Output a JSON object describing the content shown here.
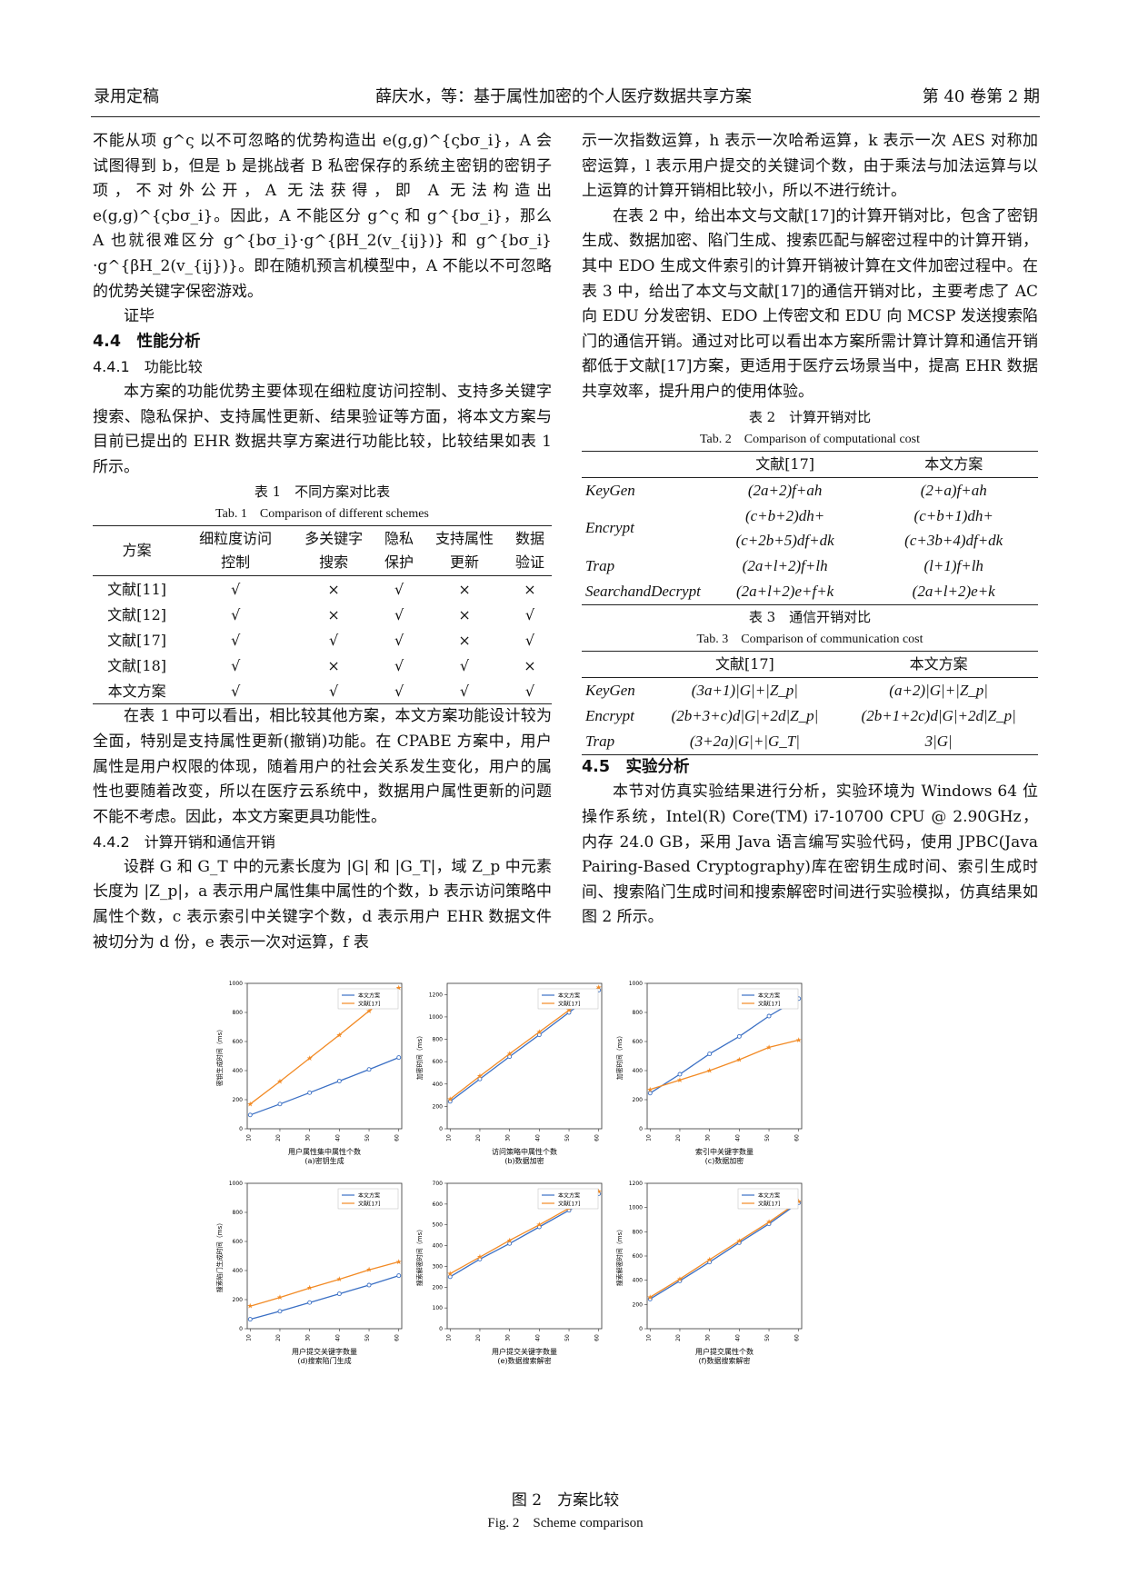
{
  "header": {
    "left": "录用定稿",
    "center": "薛庆水，等：基于属性加密的个人医疗数据共享方案",
    "right": "第 40 卷第 2 期"
  },
  "left": {
    "p1": "不能从项 g^ς 以不可忽略的优势构造出 e(g,g)^{ςbσ_i}，A 会试图得到 b，但是 b 是挑战者 B 私密保存的系统主密钥的密钥子项，不对外公开，A 无法获得，即 A 无法构造出 e(g,g)^{ςbσ_i}。因此，A 不能区分 g^ς 和 g^{bσ_i}，那么 A 也就很难区分 g^{bσ_i}·g^{βH_2(v_{ij})} 和 g^{bσ_i}·g^{βH_2(v_{ij})}。即在随机预言机模型中，A 不能以不可忽略的优势关键字保密游戏。",
    "qed": "证毕",
    "s44": "4.4　性能分析",
    "s441": "4.4.1　功能比较",
    "p2": "本方案的功能优势主要体现在细粒度访问控制、支持多关键字搜索、隐私保护、支持属性更新、结果验证等方面，将本文方案与目前已提出的 EHR 数据共享方案进行功能比较，比较结果如表 1 所示。",
    "t1_cn": "表 1　不同方案对比表",
    "t1_en": "Tab. 1　Comparison of different schemes",
    "p3": "在表 1 中可以看出，相比较其他方案，本文方案功能设计较为全面，特别是支持属性更新(撤销)功能。在 CPABE 方案中，用户属性是用户权限的体现，随着用户的社会关系发生变化，用户的属性也要随着改变，所以在医疗云系统中，数据用户属性更新的问题不能不考虑。因此，本文方案更具功能性。",
    "s442": "4.4.2　计算开销和通信开销",
    "p4": "设群 G 和 G_T 中的元素长度为 |G| 和 |G_T|，域 Z_p 中元素长度为 |Z_p|，a 表示用户属性集中属性的个数，b 表示访问策略中属性个数，c 表示索引中关键字个数，d 表示用户 EHR 数据文件被切分为 d 份，e 表示一次对运算，f 表"
  },
  "right": {
    "p1": "示一次指数运算，h 表示一次哈希运算，k 表示一次 AES 对称加密运算，l 表示用户提交的关键词个数，由于乘法与加法运算与以上运算的计算开销相比较小，所以不进行统计。",
    "p2": "在表 2 中，给出本文与文献[17]的计算开销对比，包含了密钥生成、数据加密、陷门生成、搜索匹配与解密过程中的计算开销，其中 EDO 生成文件索引的计算开销被计算在文件加密过程中。在表 3 中，给出了本文与文献[17]的通信开销对比，主要考虑了 AC 向 EDU 分发密钥、EDO 上传密文和 EDU 向 MCSP 发送搜索陷门的通信开销。通过对比可以看出本方案所需计算计算和通信开销都低于文献[17]方案，更适用于医疗云场景当中，提高 EHR 数据共享效率，提升用户的使用体验。",
    "t2_cn": "表 2　计算开销对比",
    "t2_en": "Tab. 2　Comparison of computational cost",
    "t3_cn": "表 3　通信开销对比",
    "t3_en": "Tab. 3　Comparison of communication cost",
    "s45": "4.5　实验分析",
    "p3": "本节对仿真实验结果进行分析，实验环境为 Windows 64 位操作系统，Intel(R) Core(TM) i7-10700 CPU @ 2.90GHz，内存 24.0 GB，采用 Java 语言编写实验代码，使用 JPBC(Java Pairing-Based Cryptography)库在密钥生成时间、索引生成时间、搜索陷门生成时间和搜索解密时间进行实验模拟，仿真结果如图 2 所示。"
  },
  "table1": {
    "headers": [
      [
        "方案"
      ],
      [
        "细粒度访问",
        "控制"
      ],
      [
        "多关键字",
        "搜索"
      ],
      [
        "隐私",
        "保护"
      ],
      [
        "支持属性",
        "更新"
      ],
      [
        "数据",
        "验证"
      ]
    ],
    "rows": [
      [
        "文献[11]",
        "√",
        "×",
        "√",
        "×",
        "×"
      ],
      [
        "文献[12]",
        "√",
        "×",
        "√",
        "×",
        "√"
      ],
      [
        "文献[17]",
        "√",
        "√",
        "√",
        "×",
        "√"
      ],
      [
        "文献[18]",
        "√",
        "×",
        "√",
        "√",
        "×"
      ],
      [
        "本文方案",
        "√",
        "√",
        "√",
        "√",
        "√"
      ]
    ]
  },
  "table2": {
    "headers": [
      "",
      "文献[17]",
      "本文方案"
    ],
    "rows": [
      [
        "KeyGen",
        "(2a+2)f+ah",
        "(2+a)f+ah"
      ],
      [
        "Encrypt",
        "(c+b+2)dh+ (c+2b+5)df+dk",
        "(c+b+1)dh+ (c+3b+4)df+dk"
      ],
      [
        "Trap",
        "(2a+l+2)f+lh",
        "(l+1)f+lh"
      ],
      [
        "SearchandDecrypt",
        "(2a+l+2)e+f+k",
        "(2a+l+2)e+k"
      ]
    ]
  },
  "table3": {
    "headers": [
      "",
      "文献[17]",
      "本文方案"
    ],
    "rows": [
      [
        "KeyGen",
        "(3a+1)|G|+|Z_p|",
        "(a+2)|G|+|Z_p|"
      ],
      [
        "Encrypt",
        "(2b+3+c)d|G|+2d|Z_p|",
        "(2b+1+2c)d|G|+2d|Z_p|"
      ],
      [
        "Trap",
        "(3+2a)|G|+|G_T|",
        "3|G|"
      ]
    ]
  },
  "figure": {
    "caption_cn": "图 2　方案比较",
    "caption_en": "Fig. 2　Scheme comparison"
  },
  "chart_data": [
    {
      "type": "line",
      "subtitle": "(a)密钥生成",
      "xlabel": "用户属性集中属性个数",
      "ylabel": "密钥生成时间（ms）",
      "x": [
        10,
        20,
        30,
        40,
        50,
        60
      ],
      "ylim": [
        0,
        1000
      ],
      "yticks": [
        0,
        200,
        400,
        600,
        800,
        1000
      ],
      "series": [
        {
          "name": "本文方案",
          "color": "#3a6fc4",
          "values": [
            95,
            170,
            248,
            328,
            408,
            490
          ]
        },
        {
          "name": "文献[17]",
          "color": "#f28a24",
          "values": [
            170,
            325,
            485,
            645,
            810,
            970
          ]
        }
      ]
    },
    {
      "type": "line",
      "subtitle": "(b)数据加密",
      "xlabel": "访问策略中属性个数",
      "ylabel": "加密时间（ms）",
      "x": [
        10,
        20,
        30,
        40,
        50,
        60
      ],
      "ylim": [
        0,
        1300
      ],
      "yticks": [
        0,
        200,
        400,
        600,
        800,
        1000,
        1200
      ],
      "series": [
        {
          "name": "本文方案",
          "color": "#3a6fc4",
          "values": [
            245,
            445,
            645,
            840,
            1040,
            1240
          ]
        },
        {
          "name": "文献[17]",
          "color": "#f28a24",
          "values": [
            265,
            470,
            670,
            865,
            1060,
            1265
          ]
        }
      ]
    },
    {
      "type": "line",
      "subtitle": "(c)数据加密",
      "xlabel": "索引中关键字数量",
      "ylabel": "加密时间（ms）",
      "x": [
        10,
        20,
        30,
        40,
        50,
        60
      ],
      "ylim": [
        0,
        1000
      ],
      "yticks": [
        0,
        200,
        400,
        600,
        800,
        1000
      ],
      "series": [
        {
          "name": "本文方案",
          "color": "#3a6fc4",
          "values": [
            245,
            375,
            515,
            635,
            775,
            895
          ]
        },
        {
          "name": "文献[17]",
          "color": "#f28a24",
          "values": [
            270,
            335,
            400,
            475,
            560,
            610
          ]
        }
      ]
    },
    {
      "type": "line",
      "subtitle": "(d)搜索陷门生成",
      "xlabel": "用户提交关键字数量",
      "ylabel": "搜索陷门生成时间（ms）",
      "x": [
        10,
        20,
        30,
        40,
        50,
        60
      ],
      "ylim": [
        0,
        1000
      ],
      "yticks": [
        0,
        200,
        400,
        600,
        800,
        1000
      ],
      "series": [
        {
          "name": "本文方案",
          "color": "#3a6fc4",
          "values": [
            65,
            120,
            180,
            240,
            300,
            365
          ]
        },
        {
          "name": "文献[17]",
          "color": "#f28a24",
          "values": [
            155,
            215,
            280,
            340,
            405,
            460
          ]
        }
      ]
    },
    {
      "type": "line",
      "subtitle": "(e)数据搜索解密",
      "xlabel": "用户提交关键字数量",
      "ylabel": "搜索解密时间（ms）",
      "x": [
        10,
        20,
        30,
        40,
        50,
        60
      ],
      "ylim": [
        0,
        700
      ],
      "yticks": [
        0,
        100,
        200,
        300,
        400,
        500,
        600,
        700
      ],
      "series": [
        {
          "name": "本文方案",
          "color": "#3a6fc4",
          "values": [
            250,
            335,
            410,
            490,
            570,
            650
          ]
        },
        {
          "name": "文献[17]",
          "color": "#f28a24",
          "values": [
            265,
            345,
            425,
            500,
            580,
            660
          ]
        }
      ]
    },
    {
      "type": "line",
      "subtitle": "(f)数据搜索解密",
      "xlabel": "用户提交属性个数",
      "ylabel": "搜索解密时间（ms）",
      "x": [
        10,
        20,
        30,
        40,
        50,
        60
      ],
      "ylim": [
        0,
        1200
      ],
      "yticks": [
        0,
        200,
        400,
        600,
        800,
        1000,
        1200
      ],
      "series": [
        {
          "name": "本文方案",
          "color": "#3a6fc4",
          "values": [
            245,
            395,
            550,
            710,
            865,
            1040
          ]
        },
        {
          "name": "文献[17]",
          "color": "#f28a24",
          "values": [
            260,
            410,
            570,
            725,
            880,
            1050
          ]
        }
      ]
    }
  ]
}
